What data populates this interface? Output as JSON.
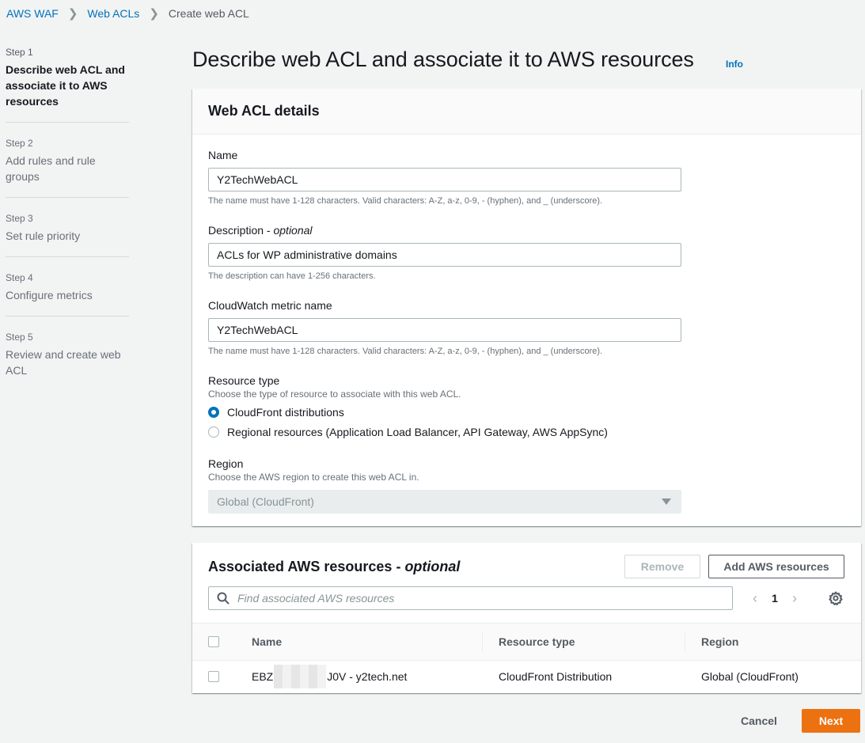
{
  "breadcrumb": {
    "items": [
      {
        "label": "AWS WAF"
      },
      {
        "label": "Web ACLs"
      }
    ],
    "current": "Create web ACL"
  },
  "steps": [
    {
      "num": "Step 1",
      "title": "Describe web ACL and associate it to AWS resources",
      "active": true
    },
    {
      "num": "Step 2",
      "title": "Add rules and rule groups"
    },
    {
      "num": "Step 3",
      "title": "Set rule priority"
    },
    {
      "num": "Step 4",
      "title": "Configure metrics"
    },
    {
      "num": "Step 5",
      "title": "Review and create web ACL"
    }
  ],
  "page": {
    "title": "Describe web ACL and associate it to AWS resources",
    "info_label": "Info"
  },
  "details": {
    "header": "Web ACL details",
    "name": {
      "label": "Name",
      "value": "Y2TechWebACL",
      "hint": "The name must have 1-128 characters. Valid characters: A-Z, a-z, 0-9, - (hyphen), and _ (underscore)."
    },
    "description": {
      "label": "Description",
      "label_optional": "optional",
      "value": "ACLs for WP administrative domains",
      "hint": "The description can have 1-256 characters."
    },
    "metric": {
      "label": "CloudWatch metric name",
      "value": "Y2TechWebACL",
      "hint": "The name must have 1-128 characters. Valid characters: A-Z, a-z, 0-9, - (hyphen), and _ (underscore)."
    },
    "resource_type": {
      "label": "Resource type",
      "description": "Choose the type of resource to associate with this web ACL.",
      "options": [
        {
          "label": "CloudFront distributions",
          "checked": true
        },
        {
          "label": "Regional resources (Application Load Balancer, API Gateway, AWS AppSync)",
          "checked": false
        }
      ]
    },
    "region": {
      "label": "Region",
      "description": "Choose the AWS region to create this web ACL in.",
      "value": "Global (CloudFront)"
    }
  },
  "associated": {
    "title": "Associated AWS resources",
    "title_optional": "optional",
    "remove_label": "Remove",
    "add_label": "Add AWS resources",
    "search_placeholder": "Find associated AWS resources",
    "page": "1",
    "columns": [
      "Name",
      "Resource type",
      "Region"
    ],
    "rows": [
      {
        "name_prefix": "EBZ",
        "name_suffix": "J0V - y2tech.net",
        "type": "CloudFront Distribution",
        "region": "Global (CloudFront)"
      }
    ]
  },
  "footer": {
    "cancel_label": "Cancel",
    "next_label": "Next"
  },
  "colors": {
    "link": "#0073bb",
    "primary_button": "#ec7211",
    "background": "#f2f3f3"
  }
}
